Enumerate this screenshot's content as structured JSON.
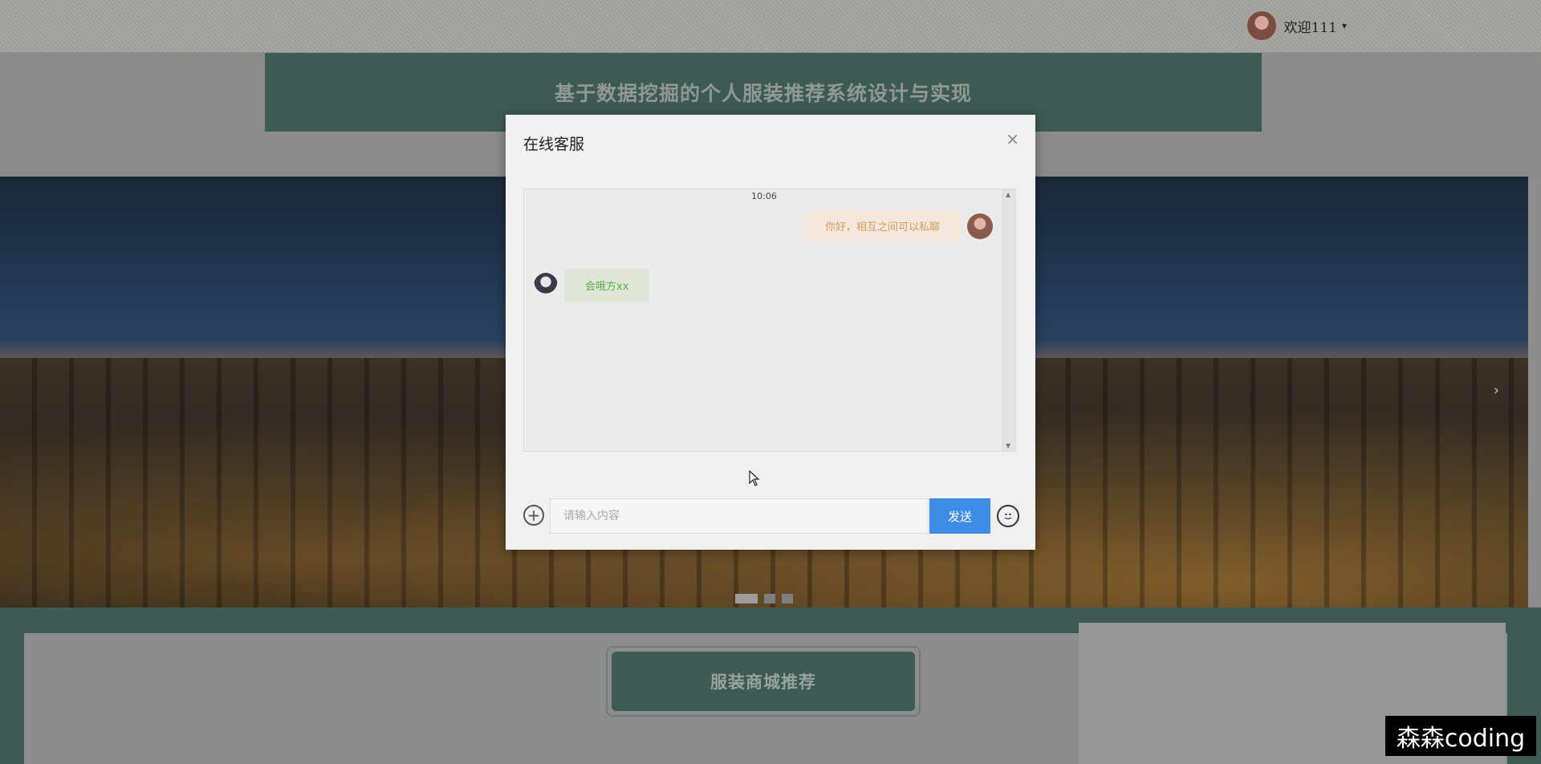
{
  "header": {
    "welcome_text": "欢迎111",
    "caret": "▾"
  },
  "site": {
    "title": "基于数据挖掘的个人服装推荐系统设计与实现"
  },
  "banner": {
    "next_arrow": "›",
    "slide_count": 3,
    "active_slide": 1
  },
  "section": {
    "title": "服装商城推荐"
  },
  "watermark": {
    "text": "森森coding"
  },
  "chat_modal": {
    "title": "在线客服",
    "close_icon": "×",
    "time": "10:06",
    "messages": [
      {
        "side": "right",
        "text": "你好，相互之间可以私聊"
      },
      {
        "side": "left",
        "text": "会哦方xx"
      }
    ],
    "input_placeholder": "请输入内容",
    "input_value": "",
    "send_label": "发送",
    "plus_icon": "+",
    "emoji_icon": "emoji-icon"
  },
  "colors": {
    "header_band": "#3d5a55",
    "send_button": "#3d8ce6",
    "bubble_right_text": "#d49a5c",
    "bubble_left_text": "#5bae45"
  }
}
